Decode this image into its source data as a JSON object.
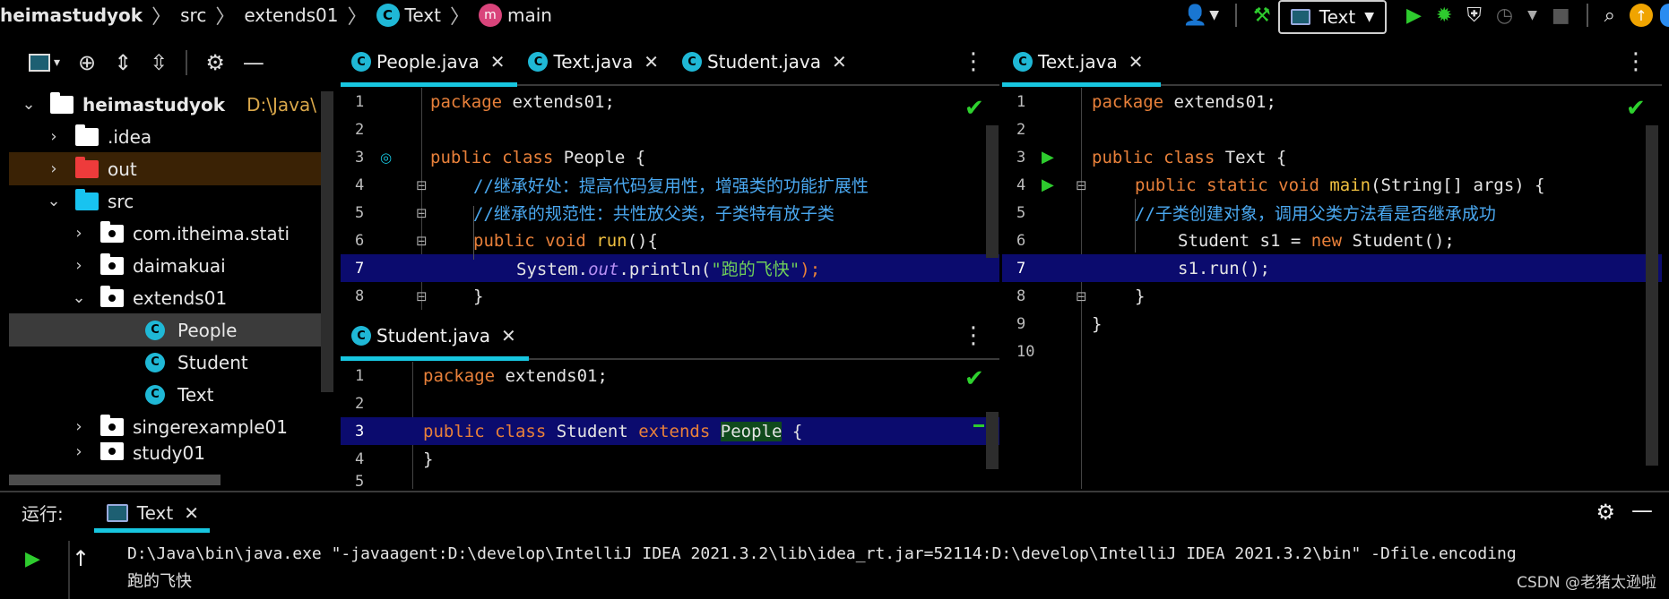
{
  "navbar": {
    "breadcrumbs": [
      "heimastudyok",
      "src",
      "extends01",
      "Text",
      "main"
    ],
    "run_config": "Text"
  },
  "project": {
    "root": {
      "name": "heimastudyok",
      "path": "D:\\Java\\"
    },
    "items": [
      {
        "name": ".idea",
        "chevron": "›"
      },
      {
        "name": "out",
        "chevron": "›"
      },
      {
        "name": "src",
        "chevron": "⌄"
      },
      {
        "name": "com.itheima.stati",
        "chevron": "›"
      },
      {
        "name": "daimakuai",
        "chevron": "›"
      },
      {
        "name": "extends01",
        "chevron": "⌄"
      },
      {
        "name": "People"
      },
      {
        "name": "Student"
      },
      {
        "name": "Text"
      },
      {
        "name": "singerexample01",
        "chevron": "›"
      },
      {
        "name": "study01",
        "chevron": "›"
      }
    ]
  },
  "editor_left": {
    "tabs": [
      {
        "label": "People.java",
        "active": true
      },
      {
        "label": "Text.java",
        "active": false
      },
      {
        "label": "Student.java",
        "active": false
      }
    ],
    "lines": [
      "1",
      "2",
      "3",
      "4",
      "5",
      "6",
      "7",
      "8"
    ],
    "code": {
      "pkg_kw": "package",
      "pkg_name": " extends01;",
      "l3_kw": "public class",
      "l3_rest": " People {",
      "l4_comment": "//继承好处：提高代码复用性，增强类的功能扩展性",
      "l5_comment": "//继承的规范性：共性放父类，子类特有放子类",
      "l6_kw": "public void",
      "l6_fn": " run",
      "l6_rest": "(){",
      "l7_a": "System.",
      "l7_field": "out",
      "l7_b": ".println(",
      "l7_str": "\"跑的飞快\"",
      "l7_c": ");",
      "l8": "}"
    }
  },
  "editor_bottom": {
    "tabs": [
      {
        "label": "Student.java",
        "active": true
      }
    ],
    "lines": [
      "1",
      "2",
      "3",
      "4",
      "5"
    ],
    "code": {
      "pkg_kw": "package",
      "pkg_name": " extends01;",
      "l3_kw1": "public class",
      "l3_name": " Student ",
      "l3_kw2": "extends",
      "l3_parent": "People",
      "l3_rest": " {",
      "l4": "}"
    }
  },
  "editor_right": {
    "tabs": [
      {
        "label": "Text.java",
        "active": true
      }
    ],
    "lines": [
      "1",
      "2",
      "3",
      "4",
      "5",
      "6",
      "7",
      "8",
      "9",
      "10"
    ],
    "code": {
      "pkg_kw": "package",
      "pkg_name": " extends01;",
      "l3_kw": "public class",
      "l3_rest": " Text {",
      "l4_kw": "public static void",
      "l4_fn": " main",
      "l4_rest": "(String[] args) {",
      "l5_comment": "//子类创建对象，调用父类方法看是否继承成功",
      "l6_a": "Student s1 = ",
      "l6_kw": "new",
      "l6_b": " Student();",
      "l7": "s1.run();",
      "l8": "}",
      "l9": "}"
    }
  },
  "run": {
    "label": "运行:",
    "tab": "Text",
    "command": "D:\\Java\\bin\\java.exe \"-javaagent:D:\\develop\\IntelliJ IDEA 2021.3.2\\lib\\idea_rt.jar=52114:D:\\develop\\IntelliJ IDEA 2021.3.2\\bin\" -Dfile.encoding",
    "output": "跑的飞快"
  },
  "watermark": "CSDN @老猪太逊啦",
  "colors": {
    "accent": "#17c6e0",
    "keyword": "#e8803a",
    "comment": "#4aa8f0",
    "string": "#6fcf5a",
    "highlight": "#0b0b6e"
  }
}
